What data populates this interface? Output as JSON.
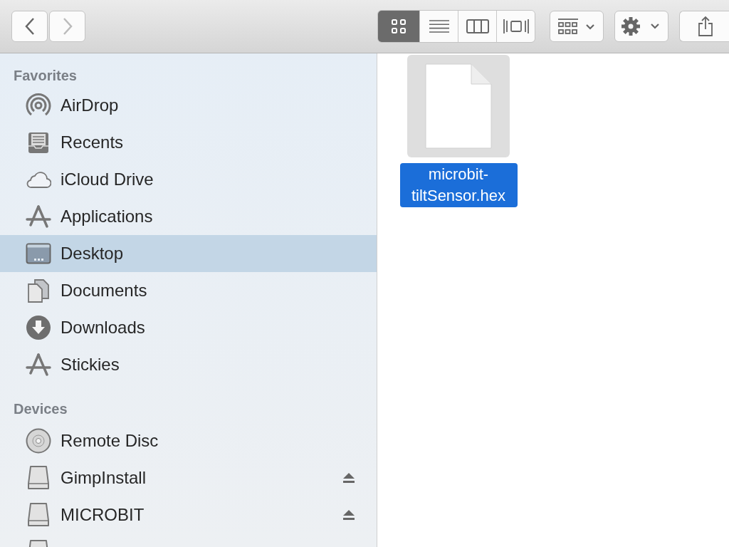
{
  "toolbar": {
    "back": {
      "disabled": false
    },
    "forward": {
      "disabled": true
    },
    "view_modes": [
      {
        "kind": "icons",
        "selected": true
      },
      {
        "kind": "list",
        "selected": false
      },
      {
        "kind": "columns",
        "selected": false
      },
      {
        "kind": "gallery",
        "selected": false
      }
    ]
  },
  "sidebar": {
    "sections": [
      {
        "title": "Favorites",
        "items": [
          {
            "kind": "airdrop",
            "label": "AirDrop",
            "selected": false
          },
          {
            "kind": "recents",
            "label": "Recents",
            "selected": false
          },
          {
            "kind": "cloud",
            "label": "iCloud Drive",
            "selected": false
          },
          {
            "kind": "apps",
            "label": "Applications",
            "selected": false
          },
          {
            "kind": "desktop",
            "label": "Desktop",
            "selected": true
          },
          {
            "kind": "documents",
            "label": "Documents",
            "selected": false
          },
          {
            "kind": "downloads",
            "label": "Downloads",
            "selected": false
          },
          {
            "kind": "apps",
            "label": "Stickies",
            "selected": false
          }
        ]
      },
      {
        "title": "Devices",
        "items": [
          {
            "kind": "disc",
            "label": "Remote Disc",
            "selected": false,
            "ejectable": false
          },
          {
            "kind": "drive",
            "label": "GimpInstall",
            "selected": false,
            "ejectable": true
          },
          {
            "kind": "drive",
            "label": "MICROBIT",
            "selected": false,
            "ejectable": true
          },
          {
            "kind": "drive",
            "selected": false
          }
        ]
      }
    ]
  },
  "files": [
    {
      "name": "microbit-tiltSensor.hex",
      "selected": true
    }
  ]
}
